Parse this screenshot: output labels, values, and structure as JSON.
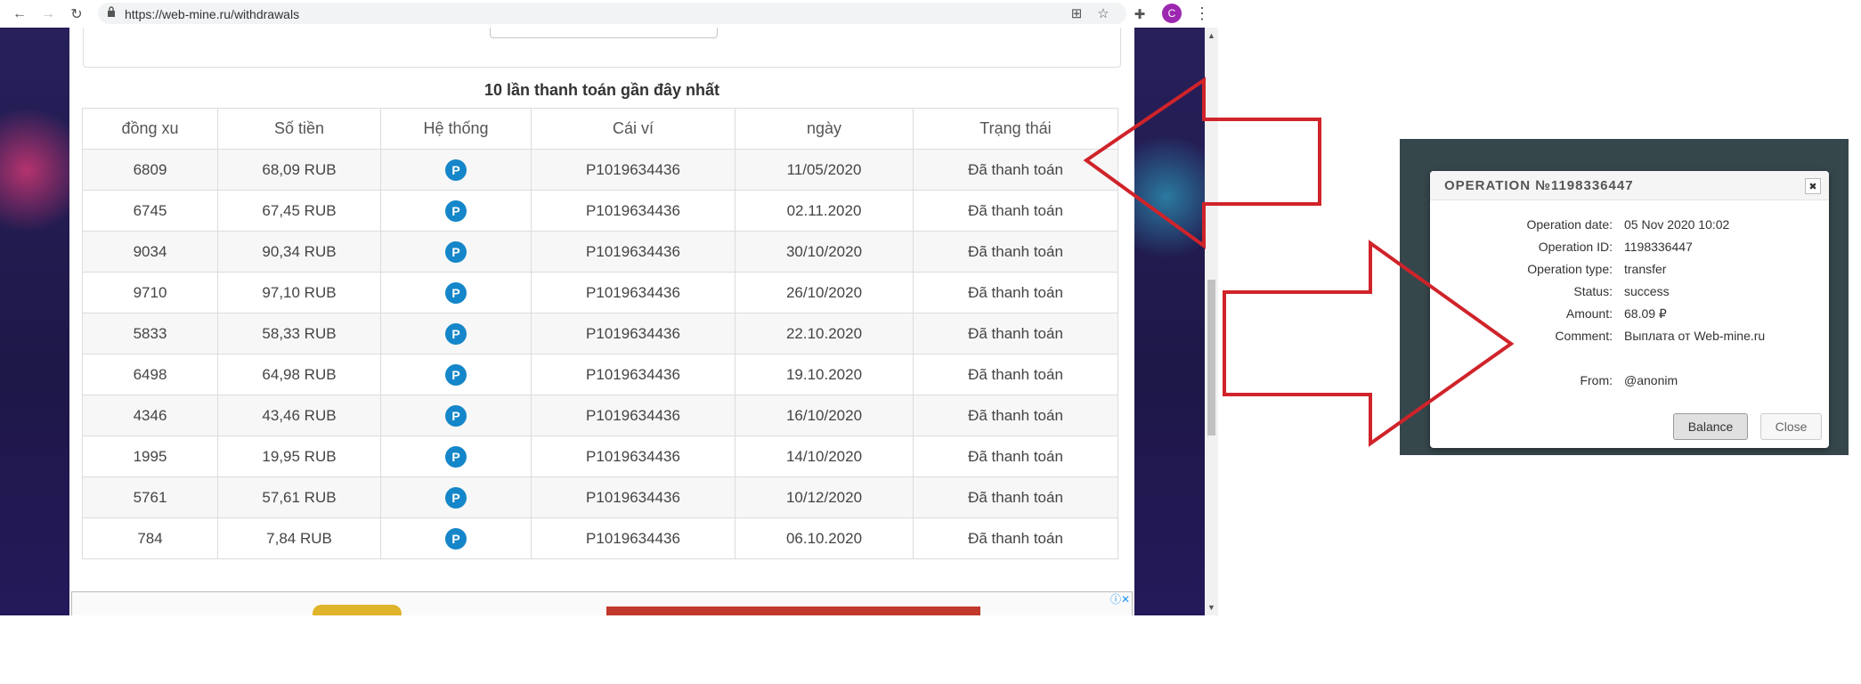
{
  "browser": {
    "url": "https://web-mine.ru/withdrawals",
    "profile_initial": "C"
  },
  "table": {
    "title": "10 lần thanh toán gần đây nhất",
    "headers": [
      "đồng xu",
      "Số tiền",
      "Hệ thống",
      "Cái ví",
      "ngày",
      "Trạng thái"
    ],
    "system_icon_letter": "P",
    "rows": [
      {
        "coins": "6809",
        "amount": "68,09 RUB",
        "wallet": "P1019634436",
        "date": "11/05/2020",
        "status": "Đã thanh toán"
      },
      {
        "coins": "6745",
        "amount": "67,45 RUB",
        "wallet": "P1019634436",
        "date": "02.11.2020",
        "status": "Đã thanh toán"
      },
      {
        "coins": "9034",
        "amount": "90,34 RUB",
        "wallet": "P1019634436",
        "date": "30/10/2020",
        "status": "Đã thanh toán"
      },
      {
        "coins": "9710",
        "amount": "97,10 RUB",
        "wallet": "P1019634436",
        "date": "26/10/2020",
        "status": "Đã thanh toán"
      },
      {
        "coins": "5833",
        "amount": "58,33 RUB",
        "wallet": "P1019634436",
        "date": "22.10.2020",
        "status": "Đã thanh toán"
      },
      {
        "coins": "6498",
        "amount": "64,98 RUB",
        "wallet": "P1019634436",
        "date": "19.10.2020",
        "status": "Đã thanh toán"
      },
      {
        "coins": "4346",
        "amount": "43,46 RUB",
        "wallet": "P1019634436",
        "date": "16/10/2020",
        "status": "Đã thanh toán"
      },
      {
        "coins": "1995",
        "amount": "19,95 RUB",
        "wallet": "P1019634436",
        "date": "14/10/2020",
        "status": "Đã thanh toán"
      },
      {
        "coins": "5761",
        "amount": "57,61 RUB",
        "wallet": "P1019634436",
        "date": "10/12/2020",
        "status": "Đã thanh toán"
      },
      {
        "coins": "784",
        "amount": "7,84 RUB",
        "wallet": "P1019634436",
        "date": "06.10.2020",
        "status": "Đã thanh toán"
      }
    ]
  },
  "modal": {
    "title": "OPERATION №1198336447",
    "close_glyph": "✖",
    "fields": [
      {
        "label": "Operation date:",
        "value": "05 Nov 2020 10:02"
      },
      {
        "label": "Operation ID:",
        "value": "1198336447"
      },
      {
        "label": "Operation type:",
        "value": "transfer"
      },
      {
        "label": "Status:",
        "value": "success"
      },
      {
        "label": "Amount:",
        "value": "68.09 ₽"
      },
      {
        "label": "Comment:",
        "value": "Выплата от Web-mine.ru"
      }
    ],
    "from_label": "From:",
    "from_value": "@anonim",
    "balance_button": "Balance",
    "close_button": "Close"
  },
  "colors": {
    "arrow": "#d0232a",
    "payeer_blue": "#1486c9",
    "modal_backdrop": "#36474c"
  }
}
